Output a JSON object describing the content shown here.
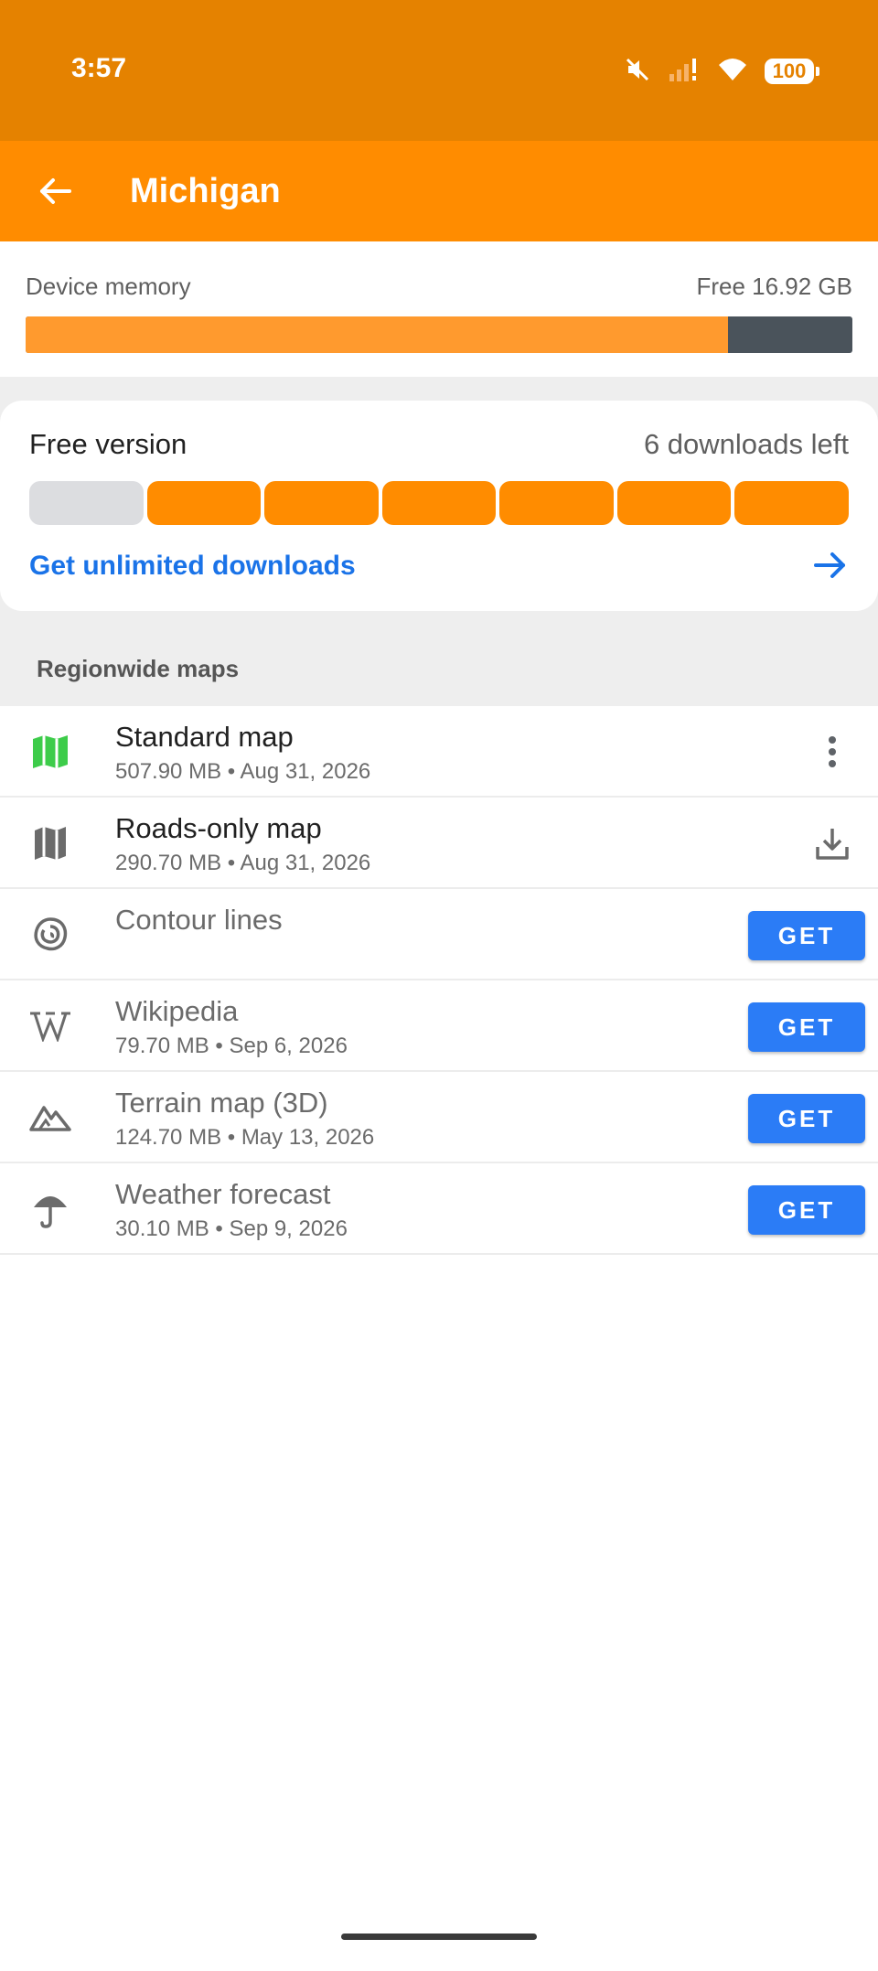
{
  "status_bar": {
    "time": "3:57",
    "battery": "100",
    "icons": [
      "mute-icon",
      "signal-icon",
      "wifi-icon",
      "battery-icon"
    ]
  },
  "toolbar": {
    "title": "Michigan",
    "back_icon": "arrow-left-icon"
  },
  "memory": {
    "label": "Device memory",
    "free": "Free 16.92 GB",
    "used_fraction": 0.85
  },
  "free_version": {
    "label": "Free version",
    "downloads_left": "6 downloads left",
    "segments_total": 7,
    "segments_used": 1,
    "link": "Get unlimited downloads"
  },
  "section": {
    "header": "Regionwide maps"
  },
  "maps": [
    {
      "icon": "map-green-icon",
      "title": "Standard map",
      "subtitle": "507.90 MB • Aug 31, 2026",
      "action": "more-icon"
    },
    {
      "icon": "map-gray-icon",
      "title": "Roads-only map",
      "subtitle": "290.70 MB • Aug 31, 2026",
      "action": "download-icon"
    },
    {
      "icon": "contour-icon",
      "title": "Contour lines",
      "subtitle": "",
      "action": "GET"
    },
    {
      "icon": "wikipedia-icon",
      "title": "Wikipedia",
      "subtitle": "79.70 MB • Sep 6, 2026",
      "action": "GET"
    },
    {
      "icon": "terrain-icon",
      "title": "Terrain map (3D)",
      "subtitle": "124.70 MB • May 13, 2026",
      "action": "GET"
    },
    {
      "icon": "umbrella-icon",
      "title": "Weather forecast",
      "subtitle": "30.10 MB • Sep 9, 2026",
      "action": "GET"
    }
  ],
  "colors": {
    "status_bar": "#e58200",
    "toolbar": "#ff8c00",
    "accent_blue": "#2b7cf6",
    "link_blue": "#1a73e8",
    "map_green": "#3dcc4a"
  }
}
